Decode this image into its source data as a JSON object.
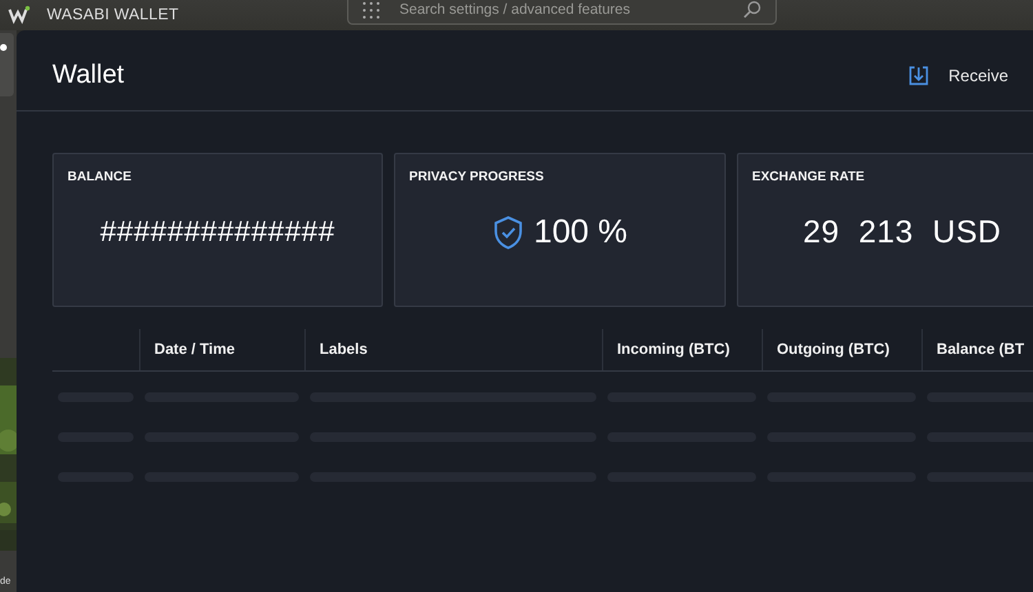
{
  "window": {
    "title": "WASABI WALLET"
  },
  "search": {
    "placeholder": "Search settings / advanced features"
  },
  "sidebar": {
    "text": "de"
  },
  "page": {
    "title": "Wallet",
    "action": "Receive"
  },
  "cards": [
    {
      "kind": "masked",
      "title": "BALANCE",
      "value": "##############"
    },
    {
      "kind": "privacy",
      "title": "PRIVACY PROGRESS",
      "value": "100 %"
    },
    {
      "kind": "rate",
      "title": "EXCHANGE RATE",
      "value": "29  213  USD"
    }
  ],
  "table": {
    "columns": [
      "Date / Time",
      "Labels",
      "Incoming (BTC)",
      "Outgoing (BTC)",
      "Balance (BT"
    ],
    "loading_rows": [
      {
        "kind": "placeholder"
      },
      {
        "kind": "placeholder"
      },
      {
        "kind": "placeholder"
      }
    ]
  }
}
